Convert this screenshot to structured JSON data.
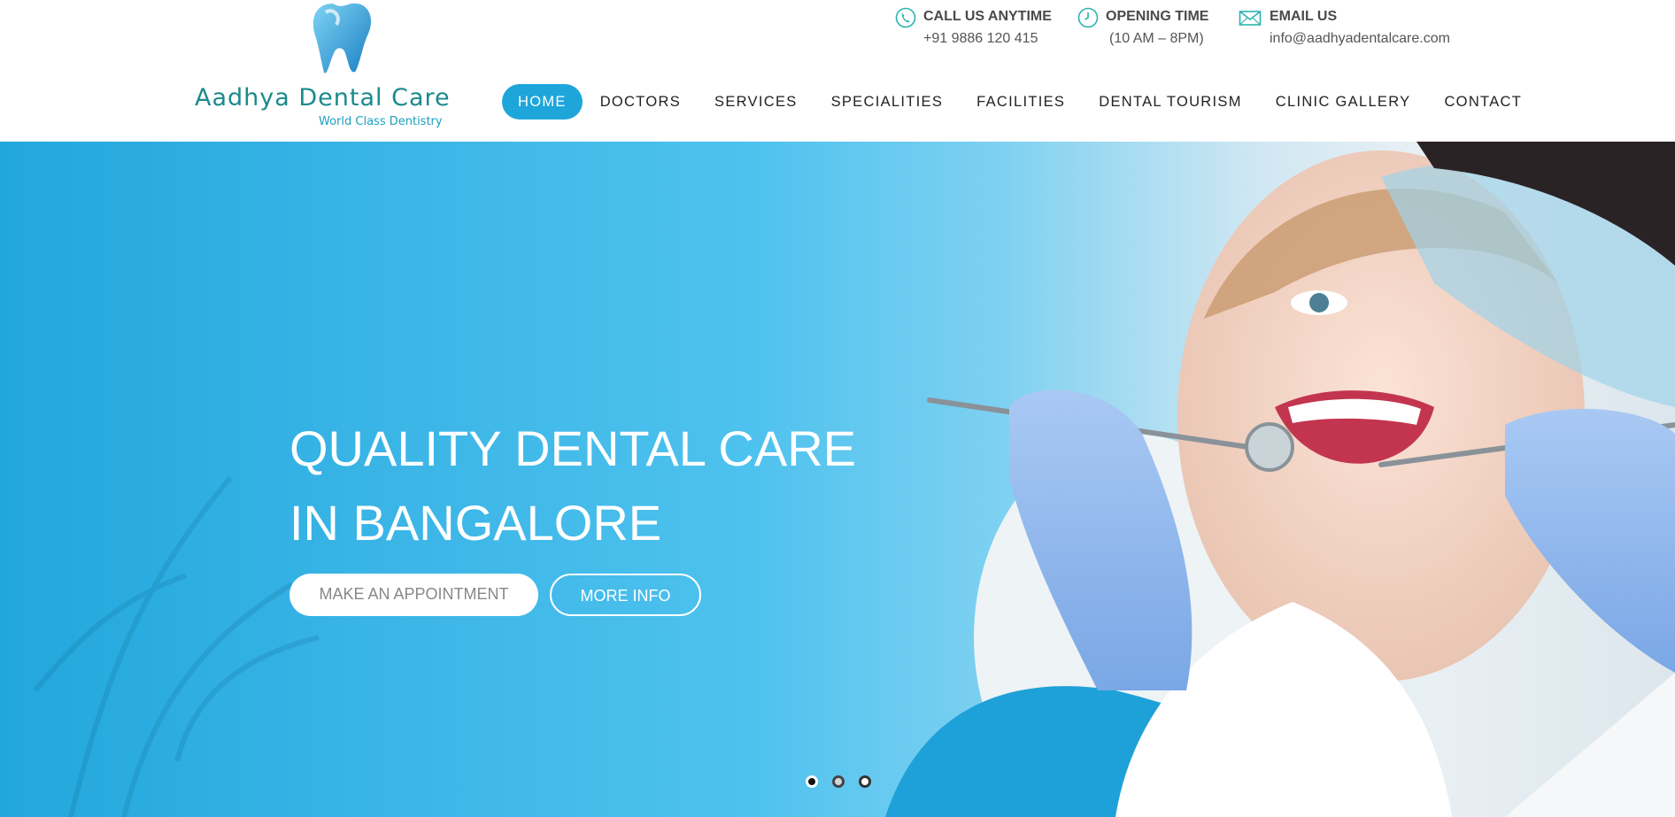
{
  "brand": {
    "name": "Aadhya Dental Care",
    "tagline": "World Class Dentistry",
    "color": "#1a8a8c"
  },
  "contacts": [
    {
      "icon": "phone-icon",
      "title": "CALL US ANYTIME",
      "value": "+91 9886 120 415"
    },
    {
      "icon": "clock-icon",
      "title": "OPENING TIME",
      "value": "(10 AM – 8PM)"
    },
    {
      "icon": "envelope-icon",
      "title": "EMAIL US",
      "value": "info@aadhyadentalcare.com"
    }
  ],
  "nav": {
    "items": [
      "HOME",
      "DOCTORS",
      "SERVICES",
      "SPECIALITIES",
      "FACILITIES",
      "DENTAL TOURISM",
      "CLINIC GALLERY",
      "CONTACT"
    ],
    "active": "HOME",
    "accent": "#1ea6db"
  },
  "hero": {
    "line1": "QUALITY DENTAL CARE",
    "line2": "IN BANGALORE",
    "primary_button": "MAKE AN APPOINTMENT",
    "secondary_button": "MORE INFO",
    "slides": 3,
    "current_slide": 1
  }
}
